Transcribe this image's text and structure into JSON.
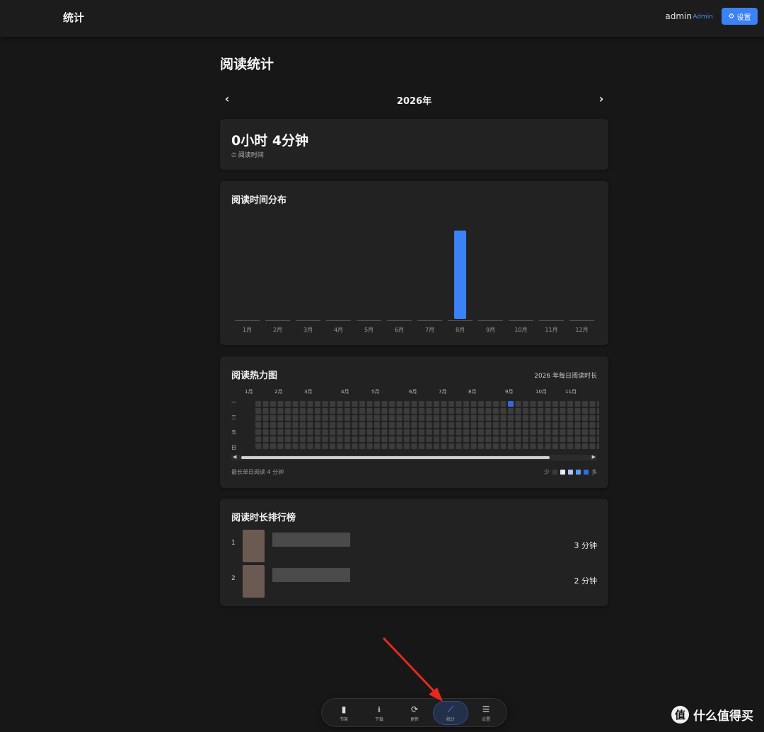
{
  "header": {
    "title": "统计",
    "user": "admin",
    "role": "Admin",
    "settings_label": "设置"
  },
  "page": {
    "title": "阅读统计",
    "year": "2026年"
  },
  "total": {
    "value": "0小时 4分钟",
    "label": "阅读时间"
  },
  "distribution": {
    "title": "阅读时间分布"
  },
  "chart_data": {
    "type": "bar",
    "categories": [
      "1月",
      "2月",
      "3月",
      "4月",
      "5月",
      "6月",
      "7月",
      "8月",
      "9月",
      "10月",
      "11月",
      "12月"
    ],
    "values": [
      0,
      0,
      0,
      0,
      0,
      0,
      0,
      4,
      0,
      0,
      0,
      0
    ],
    "color": "#3b82f6"
  },
  "heatmap": {
    "title": "阅读热力图",
    "subtitle": "2026 年每日阅读时长",
    "months": [
      "1月",
      "2月",
      "3月",
      "4月",
      "5月",
      "6月",
      "7月",
      "8月",
      "9月",
      "10月",
      "11月"
    ],
    "days": [
      "一",
      "三",
      "五",
      "日"
    ],
    "weeks": 48,
    "active_week": 34,
    "active_day": 0,
    "footer": "最长单日阅读 4 分钟",
    "legend_less": "少",
    "legend_more": "多",
    "legend_colors": [
      "#3a3a3a",
      "#e8eef8",
      "#a9c8f5",
      "#5b9bf0",
      "#2e6ee6"
    ],
    "empty_color": "#3c3c3c",
    "active_color": "#2f6ae0"
  },
  "ranking": {
    "title": "阅读时长排行榜",
    "rows": [
      {
        "rank": "1",
        "value": "3 分钟"
      },
      {
        "rank": "2",
        "value": "2 分钟"
      }
    ]
  },
  "bottom_nav": [
    {
      "label": "书架",
      "icon": "book-icon",
      "glyph": "▮"
    },
    {
      "label": "下载",
      "icon": "download-icon",
      "glyph": "⭳"
    },
    {
      "label": "更新",
      "icon": "refresh-icon",
      "glyph": "⟳"
    },
    {
      "label": "统计",
      "icon": "chart-line-icon",
      "glyph": "⟋"
    },
    {
      "label": "设置",
      "icon": "sliders-icon",
      "glyph": "☰"
    }
  ],
  "watermark": {
    "text": "什么值得买",
    "logo": "值"
  }
}
